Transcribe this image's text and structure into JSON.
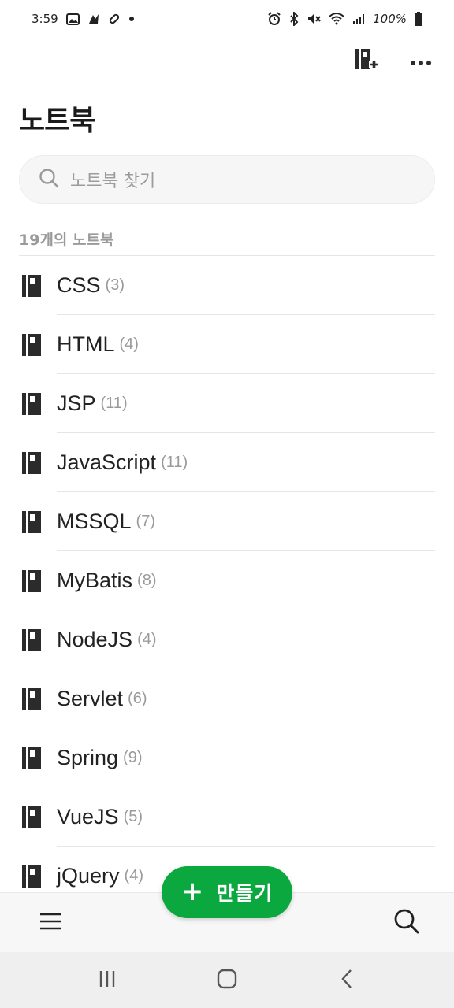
{
  "status_bar": {
    "time": "3:59",
    "battery": "100%",
    "left_icons": [
      "image-icon",
      "app-notification-icon",
      "pill-icon",
      "dot-icon"
    ],
    "right_icons": [
      "alarm-icon",
      "bluetooth-icon",
      "mute-icon",
      "wifi-icon",
      "signal-icon",
      "battery-icon"
    ]
  },
  "top_actions": {
    "new_notebook_icon": "notebook-add-icon",
    "more_icon": "more-horizontal-icon"
  },
  "page": {
    "title": "노트북"
  },
  "search": {
    "placeholder": "노트북 찾기",
    "icon": "search-icon"
  },
  "list": {
    "count_label": "19개의 노트북",
    "items": [
      {
        "name": "CSS",
        "count": "(3)"
      },
      {
        "name": "HTML",
        "count": "(4)"
      },
      {
        "name": "JSP",
        "count": "(11)"
      },
      {
        "name": "JavaScript",
        "count": "(11)"
      },
      {
        "name": "MSSQL",
        "count": "(7)"
      },
      {
        "name": "MyBatis",
        "count": "(8)"
      },
      {
        "name": "NodeJS",
        "count": "(4)"
      },
      {
        "name": "Servlet",
        "count": "(6)"
      },
      {
        "name": "Spring",
        "count": "(9)"
      },
      {
        "name": "VueJS",
        "count": "(5)"
      },
      {
        "name": "jQuery",
        "count": "(4)"
      }
    ]
  },
  "fab": {
    "plus": "+",
    "label": "만들기",
    "color": "#0aa83f"
  },
  "bottom_bar": {
    "menu_icon": "hamburger-menu-icon",
    "search_icon": "search-icon"
  },
  "nav_bar": {
    "recents_icon": "recents-icon",
    "home_icon": "home-icon",
    "back_icon": "back-icon"
  }
}
